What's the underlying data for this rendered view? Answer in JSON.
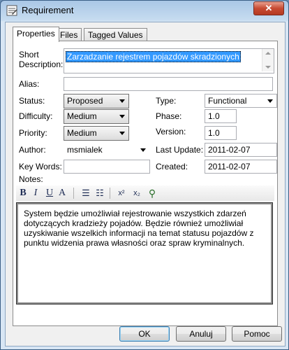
{
  "window": {
    "title": "Requirement",
    "close_glyph": "✕"
  },
  "tabs": [
    {
      "label": "Properties",
      "active": true
    },
    {
      "label": "Files",
      "active": false
    },
    {
      "label": "Tagged Values",
      "active": false
    }
  ],
  "fields": {
    "short_description_label_1": "Short",
    "short_description_label_2": "Description:",
    "short_description_value": "Zarzadzanie rejestrem pojazdów skradzionych",
    "alias_label": "Alias:",
    "alias_value": "",
    "status_label": "Status:",
    "status_value": "Proposed",
    "difficulty_label": "Difficulty:",
    "difficulty_value": "Medium",
    "priority_label": "Priority:",
    "priority_value": "Medium",
    "author_label": "Author:",
    "author_value": "msmialek",
    "keywords_label": "Key Words:",
    "keywords_value": "",
    "type_label": "Type:",
    "type_value": "Functional",
    "phase_label": "Phase:",
    "phase_value": "1.0",
    "version_label": "Version:",
    "version_value": "1.0",
    "last_update_label": "Last Update:",
    "last_update_value": "2011-02-07",
    "created_label": "Created:",
    "created_value": "2011-02-07",
    "notes_label": "Notes:"
  },
  "toolbar": {
    "bold": "B",
    "italic": "I",
    "underline": "U",
    "font_color": "A",
    "bullets": "☰",
    "numbered": "☷",
    "superscript": "x²",
    "subscript": "x₂",
    "hyperlink": "⚲"
  },
  "notes_text": "System będzie umożliwiał rejestrowanie wszystkich zdarzeń dotyczących kradzieży pojadów. Będzie również umożliwiał uzyskiwanie wszelkich informacji na temat statusu pojazdów z punktu widzenia prawa własności oraz spraw kryminalnych.",
  "buttons": {
    "ok": "OK",
    "cancel": "Anuluj",
    "help": "Pomoc"
  },
  "icons": {
    "title_icon": "requirement-icon"
  }
}
